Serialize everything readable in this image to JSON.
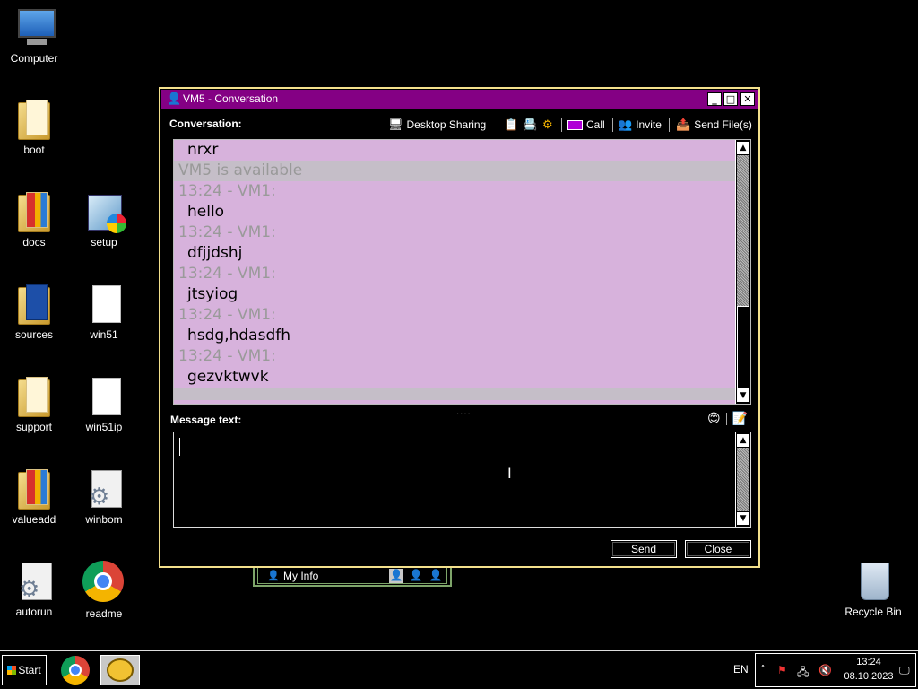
{
  "desktop": {
    "icons": {
      "computer": "Computer",
      "boot": "boot",
      "docs": "docs",
      "setup": "setup",
      "sources": "sources",
      "win51": "win51",
      "support": "support",
      "win51ip": "win51ip",
      "valueadd": "valueadd",
      "winbom": "winbom",
      "autorun": "autorun",
      "readme": "readme",
      "recycle_bin": "Recycle Bin"
    }
  },
  "back_window": {
    "label": "My Info"
  },
  "conversation_window": {
    "title": "VM5 - Conversation",
    "toolbar": {
      "label": "Conversation:",
      "desktop_sharing": "Desktop Sharing",
      "call": "Call",
      "invite": "Invite",
      "send_files": "Send File(s)"
    },
    "messages": [
      {
        "kind": "msg",
        "text": "nrxr"
      },
      {
        "kind": "status",
        "text": "VM5 is available"
      },
      {
        "kind": "hdr",
        "text": "13:24 - VM1:"
      },
      {
        "kind": "msg",
        "text": "hello"
      },
      {
        "kind": "hdr",
        "text": "13:24 - VM1:"
      },
      {
        "kind": "msg",
        "text": "dfjjdshj"
      },
      {
        "kind": "hdr",
        "text": "13:24 - VM1:"
      },
      {
        "kind": "msg",
        "text": "jtsyiog"
      },
      {
        "kind": "hdr",
        "text": "13:24 - VM1:"
      },
      {
        "kind": "msg",
        "text": "hsdg,hdasdfh"
      },
      {
        "kind": "hdr",
        "text": "13:24 - VM1:"
      },
      {
        "kind": "msg",
        "text": "gezvktwvk"
      }
    ],
    "message_label": "Message text:",
    "message_value": "",
    "send_label": "Send",
    "close_label": "Close"
  },
  "taskbar": {
    "start_label": "Start",
    "language": "EN",
    "time": "13:24",
    "date": "08.10.2023"
  },
  "colors": {
    "title_bar": "#840084",
    "chat_background": "#d7b2dc",
    "status_row": "#c5bec8",
    "window_border": "#f3e08c"
  }
}
